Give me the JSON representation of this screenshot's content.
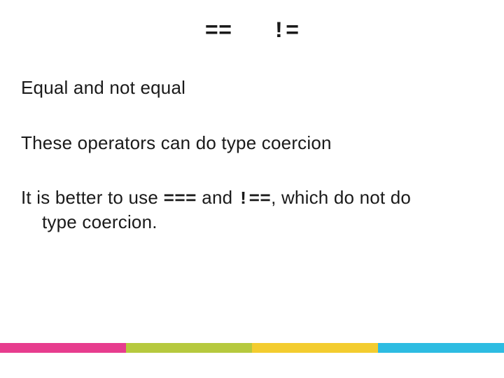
{
  "slide": {
    "title": "==   !=",
    "line1": "Equal and not equal",
    "line2": "These operators can do type coercion",
    "line3": {
      "pre": "It is better to use ",
      "op1": "===",
      "mid": " and ",
      "op2": "!==",
      "post_a": ", which do not do",
      "post_b": "type coercion."
    }
  }
}
